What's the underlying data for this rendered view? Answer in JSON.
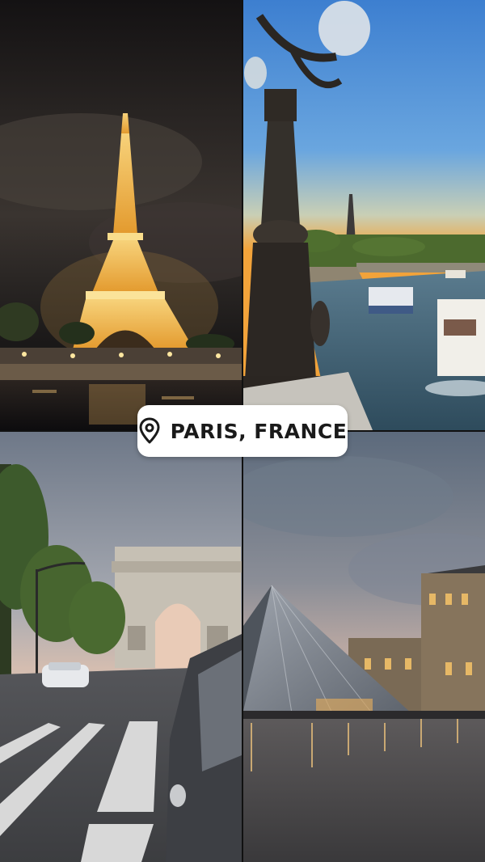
{
  "sticker": {
    "icon": "location-pin-icon",
    "label": "PARIS, FRANCE"
  },
  "tiles": [
    {
      "subject": "eiffel-tower-night"
    },
    {
      "subject": "seine-river-sunset"
    },
    {
      "subject": "arc-de-triomphe"
    },
    {
      "subject": "louvre-pyramid"
    }
  ],
  "colors": {
    "sticker_bg": "#ffffff",
    "sticker_text": "#1a1a1a",
    "night_sky": "#1c1a1d",
    "sunset_sky_top": "#3d7fd0",
    "sunset_glow": "#f2a33a",
    "dusk_sky": "#6e7888"
  }
}
